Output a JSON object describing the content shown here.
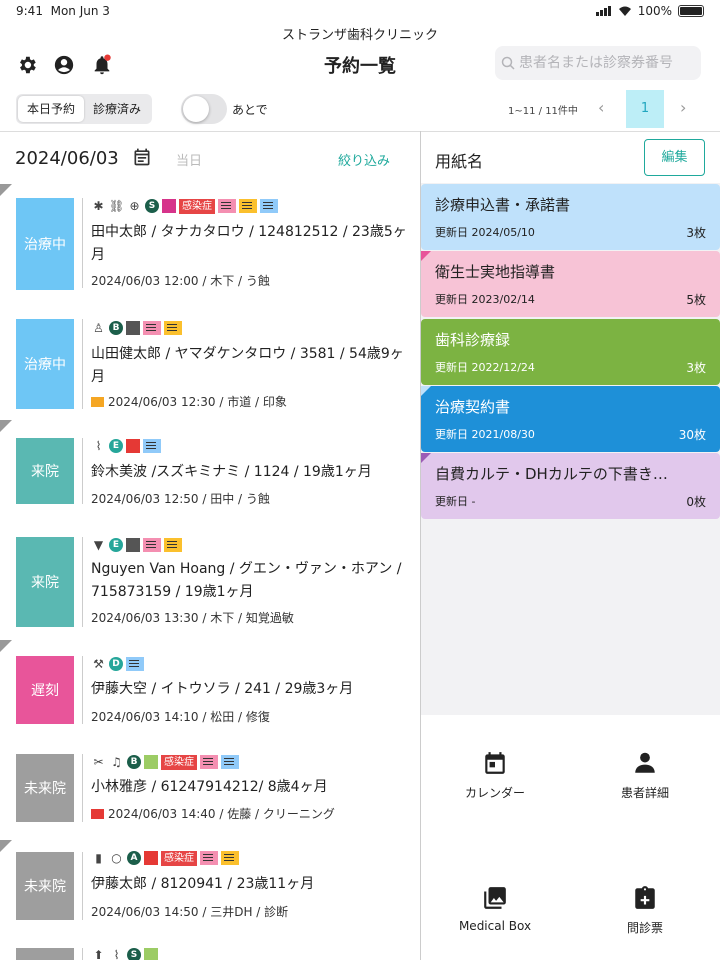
{
  "status_bar": {
    "time": "9:41",
    "date": "Mon Jun 3",
    "battery": "100%"
  },
  "header": {
    "clinic_name": "ストランザ歯科クリニック",
    "title": "予約一覧",
    "search_placeholder": "患者名または診察券番号"
  },
  "toolbar": {
    "segments": [
      "本日予約",
      "診療済み"
    ],
    "toggle_label": "あとで",
    "range_text": "1~11 / 11件中",
    "current_page": "1"
  },
  "date_bar": {
    "date": "2024/06/03",
    "today_label": "当日",
    "filter_label": "絞り込み"
  },
  "appointments": [
    {
      "status": "治療中",
      "status_color": "#6ec6f5",
      "name_line": "田中太郎 / タナカタロウ / 124812512 / 23歳5ヶ月",
      "meta": "2024/06/03 12:00 / 木下 / う蝕",
      "badge": "感染症",
      "flag": ""
    },
    {
      "status": "治療中",
      "status_color": "#6ec6f5",
      "name_line": "山田健太郎 / ヤマダケンタロウ / 3581 / 54歳9ヶ月",
      "meta": "2024/06/03 12:30 / 市道 / 印象",
      "badge": "",
      "flag": "#f5a623"
    },
    {
      "status": "来院",
      "status_color": "#5ab8b2",
      "name_line": "鈴木美波 /スズキミナミ / 1124 / 19歳1ヶ月",
      "meta": "2024/06/03 12:50 / 田中 / う蝕",
      "badge": "",
      "flag": ""
    },
    {
      "status": "来院",
      "status_color": "#5ab8b2",
      "name_line": "Nguyen Van Hoang / グエン・ヴァン・ホアン / 715873159 / 19歳1ヶ月",
      "meta": "2024/06/03 13:30 / 木下 / 知覚過敏",
      "badge": "",
      "flag": ""
    },
    {
      "status": "遅刻",
      "status_color": "#e8559a",
      "name_line": "伊藤大空 / イトウソラ / 241 / 29歳3ヶ月",
      "meta": "2024/06/03 14:10 / 松田 / 修復",
      "badge": "",
      "flag": ""
    },
    {
      "status": "未来院",
      "status_color": "#9e9e9e",
      "name_line": "小林雅彦 / 61247914212/ 8歳4ヶ月",
      "meta": "2024/06/03 14:40 / 佐藤 / クリーニング",
      "badge": "感染症",
      "flag": "#e53935"
    },
    {
      "status": "未来院",
      "status_color": "#9e9e9e",
      "name_line": "伊藤太郎 / 8120941 / 23歳11ヶ月",
      "meta": "2024/06/03 14:50 / 三井DH / 診断",
      "badge": "感染症",
      "flag": ""
    },
    {
      "status": "",
      "status_color": "#9e9e9e",
      "name_line": "",
      "meta": "",
      "badge": "",
      "flag": ""
    }
  ],
  "forms_panel": {
    "title": "用紙名",
    "edit_label": "編集",
    "forms": [
      {
        "name": "診療申込書・承諾書",
        "updated": "更新日 2024/05/10",
        "count": "3枚",
        "bg": "#bfe1fb",
        "text_color": "#222",
        "corner": ""
      },
      {
        "name": "衛生士実地指導書",
        "updated": "更新日 2023/02/14",
        "count": "5枚",
        "bg": "#f7c3d6",
        "text_color": "#222",
        "corner": "#e8559a"
      },
      {
        "name": "歯科診療録",
        "updated": "更新日 2022/12/24",
        "count": "3枚",
        "bg": "#7cb342",
        "text_color": "#ffffff",
        "corner": ""
      },
      {
        "name": "治療契約書",
        "updated": "更新日 2021/08/30",
        "count": "30枚",
        "bg": "#1e90d8",
        "text_color": "#ffffff",
        "corner": "#bfe1fb"
      },
      {
        "name": "自費カルテ・DHカルテの下書き…",
        "updated": "更新日 -",
        "count": "0枚",
        "bg": "#e1c8ec",
        "text_color": "#222",
        "corner": "#9c5bb5"
      }
    ]
  },
  "bottom_nav": [
    {
      "label": "カレンダー",
      "icon": "calendar-icon"
    },
    {
      "label": "患者詳細",
      "icon": "person-icon"
    },
    {
      "label": "Medical Box",
      "icon": "photo-library-icon"
    },
    {
      "label": "問診票",
      "icon": "clipboard-plus-icon"
    }
  ]
}
